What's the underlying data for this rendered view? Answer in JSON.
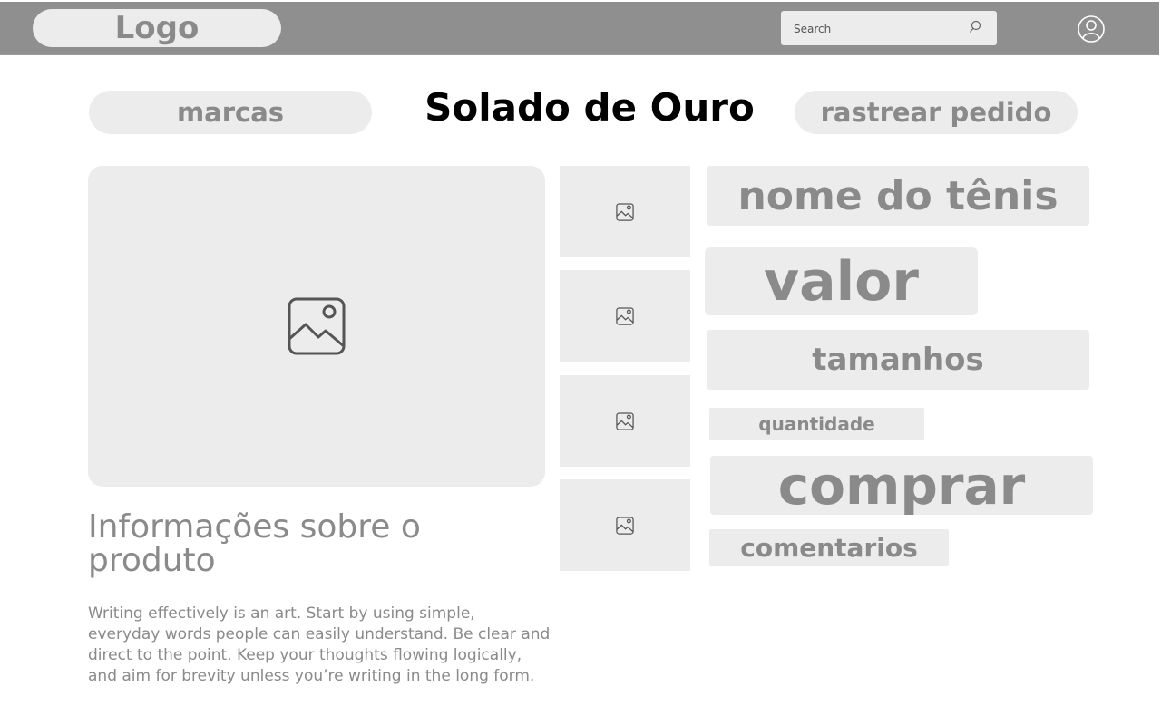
{
  "header": {
    "logo": "Logo",
    "search_placeholder": "Search",
    "search_icon": "search-icon",
    "user_icon": "user-account-icon"
  },
  "nav": {
    "brands": "marcas",
    "track_order": "rastrear pedido"
  },
  "store": {
    "title": "Solado de Ouro"
  },
  "product": {
    "name": "nome do tênis",
    "price": "valor",
    "sizes": "tamanhos",
    "quantity": "quantidade",
    "buy": "comprar",
    "reviews": "comentarios",
    "image_icon": "image-placeholder-icon",
    "thumbnail_count_shown": 4
  },
  "info": {
    "title": "Informações sobre o produto",
    "text": "Writing effectively is an art. Start by using simple, everyday words people can easily understand. Be clear and direct to the point. Keep your thoughts flowing logically, and aim for brevity unless you’re writing in the long form."
  },
  "colors": {
    "header_bg": "#8f8f8f",
    "placeholder_bg": "#ececec",
    "muted_text": "#8a8a8a",
    "title_text": "#000000"
  }
}
